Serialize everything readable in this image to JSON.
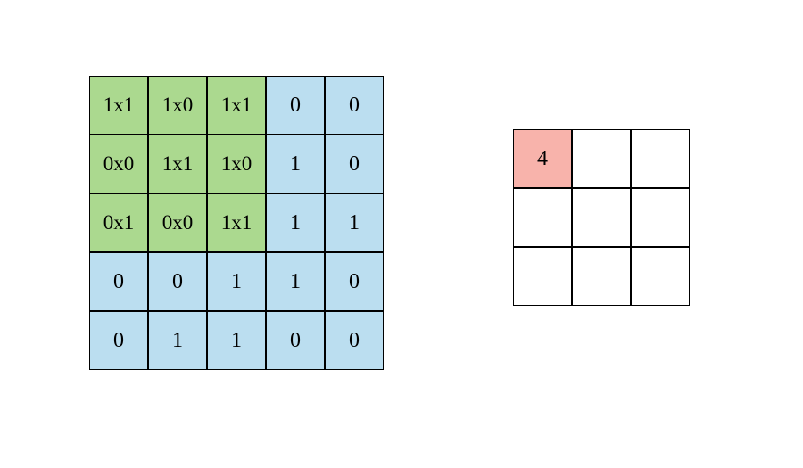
{
  "input_grid": {
    "rows": [
      [
        {
          "text": "1x1",
          "color": "green"
        },
        {
          "text": "1x0",
          "color": "green"
        },
        {
          "text": "1x1",
          "color": "green"
        },
        {
          "text": "0",
          "color": "blue"
        },
        {
          "text": "0",
          "color": "blue"
        }
      ],
      [
        {
          "text": "0x0",
          "color": "green"
        },
        {
          "text": "1x1",
          "color": "green"
        },
        {
          "text": "1x0",
          "color": "green"
        },
        {
          "text": "1",
          "color": "blue"
        },
        {
          "text": "0",
          "color": "blue"
        }
      ],
      [
        {
          "text": "0x1",
          "color": "green"
        },
        {
          "text": "0x0",
          "color": "green"
        },
        {
          "text": "1x1",
          "color": "green"
        },
        {
          "text": "1",
          "color": "blue"
        },
        {
          "text": "1",
          "color": "blue"
        }
      ],
      [
        {
          "text": "0",
          "color": "blue"
        },
        {
          "text": "0",
          "color": "blue"
        },
        {
          "text": "1",
          "color": "blue"
        },
        {
          "text": "1",
          "color": "blue"
        },
        {
          "text": "0",
          "color": "blue"
        }
      ],
      [
        {
          "text": "0",
          "color": "blue"
        },
        {
          "text": "1",
          "color": "blue"
        },
        {
          "text": "1",
          "color": "blue"
        },
        {
          "text": "0",
          "color": "blue"
        },
        {
          "text": "0",
          "color": "blue"
        }
      ]
    ]
  },
  "output_grid": {
    "rows": [
      [
        {
          "text": "4",
          "color": "pink"
        },
        {
          "text": "",
          "color": "white"
        },
        {
          "text": "",
          "color": "white"
        }
      ],
      [
        {
          "text": "",
          "color": "white"
        },
        {
          "text": "",
          "color": "white"
        },
        {
          "text": "",
          "color": "white"
        }
      ],
      [
        {
          "text": "",
          "color": "white"
        },
        {
          "text": "",
          "color": "white"
        },
        {
          "text": "",
          "color": "white"
        }
      ]
    ]
  }
}
